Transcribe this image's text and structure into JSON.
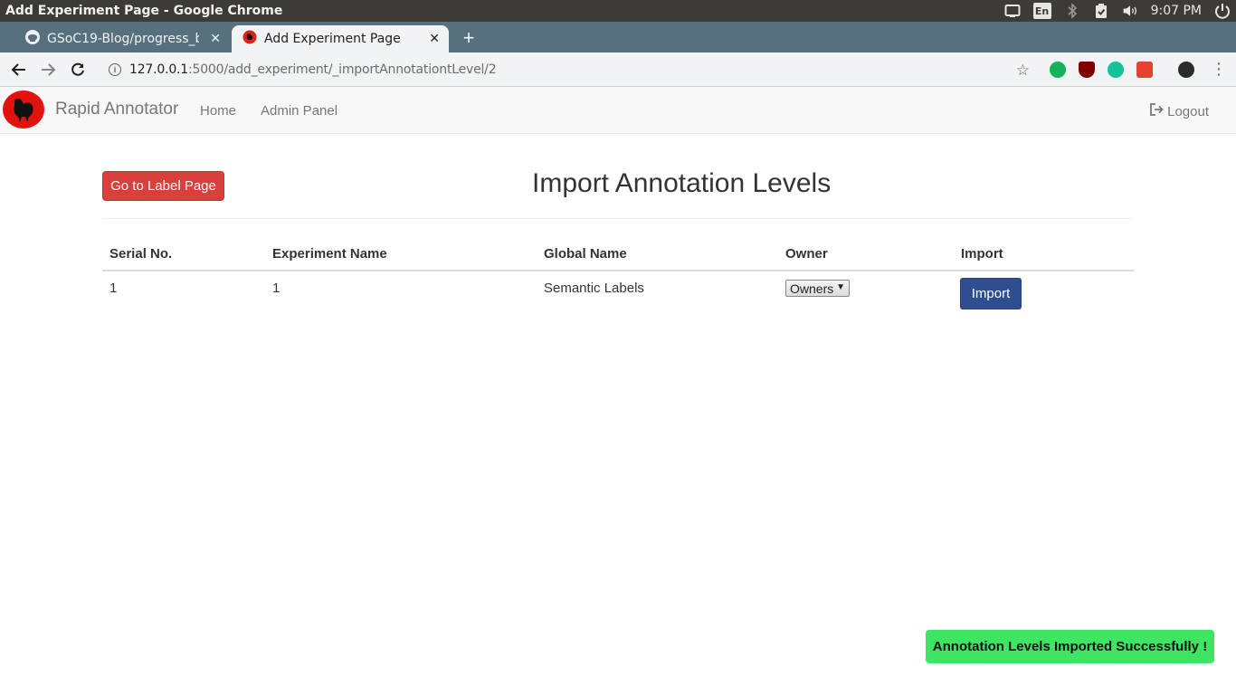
{
  "os": {
    "window_title": "Add Experiment Page - Google Chrome",
    "keyboard_layout": "En",
    "time": "9:07 PM"
  },
  "browser": {
    "tabs": [
      {
        "label": "GSoC19-Blog/progress_b",
        "active": false,
        "icon": "github-icon"
      },
      {
        "label": "Add Experiment Page",
        "active": true,
        "icon": "rooster-favicon"
      }
    ],
    "new_tab_symbol": "+",
    "url_host": "127.0.0.1",
    "url_rest": ":5000/add_experiment/_importAnnotationtLevel/2"
  },
  "app": {
    "brand": "Rapid Annotator",
    "nav": {
      "home": "Home",
      "admin": "Admin Panel",
      "logout": "Logout"
    },
    "go_label_button": "Go to Label Page",
    "page_title": "Import Annotation Levels",
    "table": {
      "headers": [
        "Serial No.",
        "Experiment Name",
        "Global Name",
        "Owner",
        "Import"
      ],
      "rows": [
        {
          "serial": "1",
          "experiment": "1",
          "global_name": "Semantic Labels",
          "owner_selected": "Owners",
          "import_label": "Import"
        }
      ]
    },
    "toast": "Annotation Levels Imported Successfully !"
  },
  "colors": {
    "os_bar": "#3c3b37",
    "tabstrip": "#56707e",
    "danger_button": "#d9403b",
    "primary_button": "#2f4e8f",
    "toast": "#3ee562"
  }
}
